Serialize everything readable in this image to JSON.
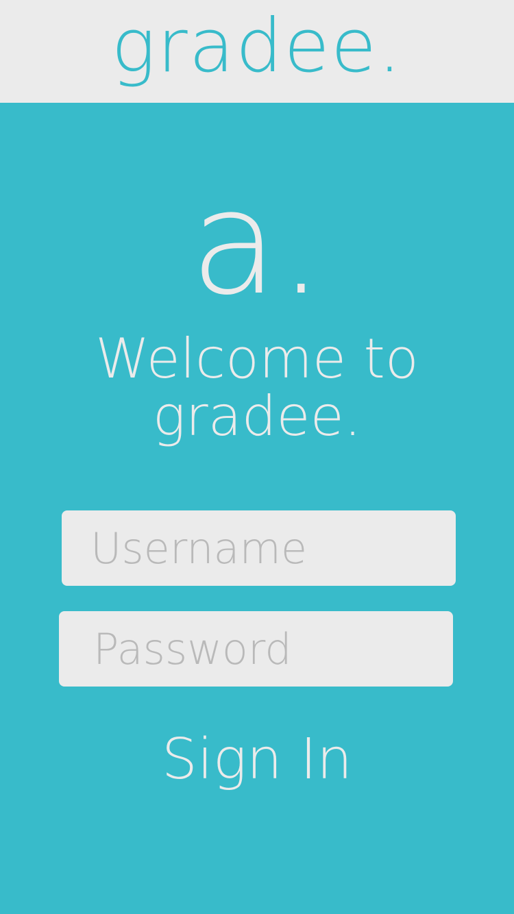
{
  "header": {
    "brand": "gradee."
  },
  "logo": {
    "mark": "a."
  },
  "welcome": {
    "line1": "Welcome to",
    "line2": "gradee."
  },
  "form": {
    "username_placeholder": "Username",
    "password_placeholder": "Password",
    "submit_label": "Sign In"
  },
  "colors": {
    "accent": "#38BBCA",
    "light": "#EBEBEB",
    "placeholder": "#B9B9B9"
  }
}
